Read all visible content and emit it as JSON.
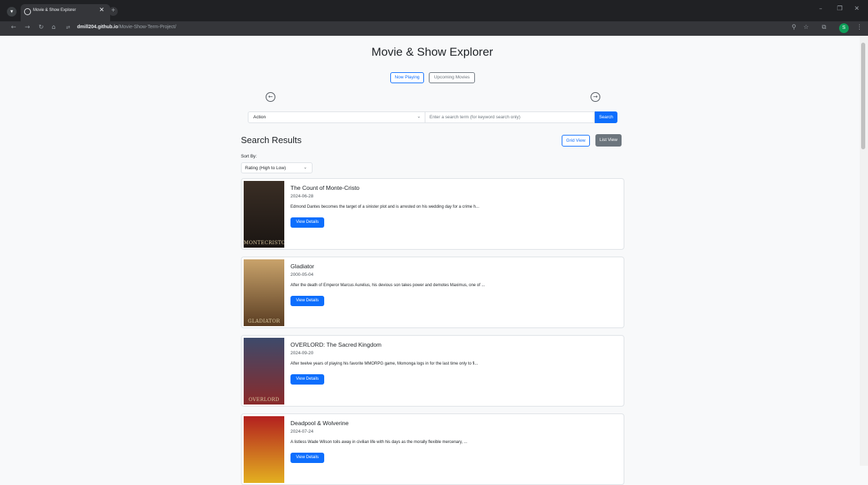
{
  "browser": {
    "tab_title": "Movie & Show Explorer",
    "url_host": "dmill204.github.io",
    "url_path": "/Movie-Show-Term-Project/",
    "profile_initial": "S"
  },
  "page": {
    "title": "Movie & Show Explorer",
    "now_playing_label": "Now Playing",
    "upcoming_label": "Upcoming Movies",
    "genre_value": "Action",
    "search_placeholder": "Enter a search term (for keyword search only)",
    "search_label": "Search",
    "results_heading": "Search Results",
    "grid_view_label": "Grid View",
    "list_view_label": "List View",
    "sort_label": "Sort By:",
    "sort_value": "Rating (High to Low)",
    "view_details_label": "View Details"
  },
  "movies": [
    {
      "title": "The Count of Monte-Cristo",
      "date": "2024-06-28",
      "description": "Edmond Dantes becomes the target of a sinister plot and is arrested on his wedding day for a crime h...",
      "poster_text": "MONTECRISTO",
      "poster_colors": [
        "#3a2e25",
        "#1a1512"
      ]
    },
    {
      "title": "Gladiator",
      "date": "2000-05-04",
      "description": "After the death of Emperor Marcus Aurelius, his devious son takes power and demotes Maximus, one of ...",
      "poster_text": "GLADIATOR",
      "poster_colors": [
        "#c9a36b",
        "#5a3d22"
      ]
    },
    {
      "title": "OVERLORD: The Sacred Kingdom",
      "date": "2024-09-20",
      "description": "After twelve years of playing his favorite MMORPG game, Momonga logs in for the last time only to fi...",
      "poster_text": "OVERLORD",
      "poster_colors": [
        "#3d4a6b",
        "#8a2a2a"
      ]
    },
    {
      "title": "Deadpool & Wolverine",
      "date": "2024-07-24",
      "description": "A listless Wade Wilson toils away in civilian life with his days as the morally flexible mercenary, ...",
      "poster_text": "",
      "poster_colors": [
        "#b3201f",
        "#e3b020"
      ]
    }
  ]
}
